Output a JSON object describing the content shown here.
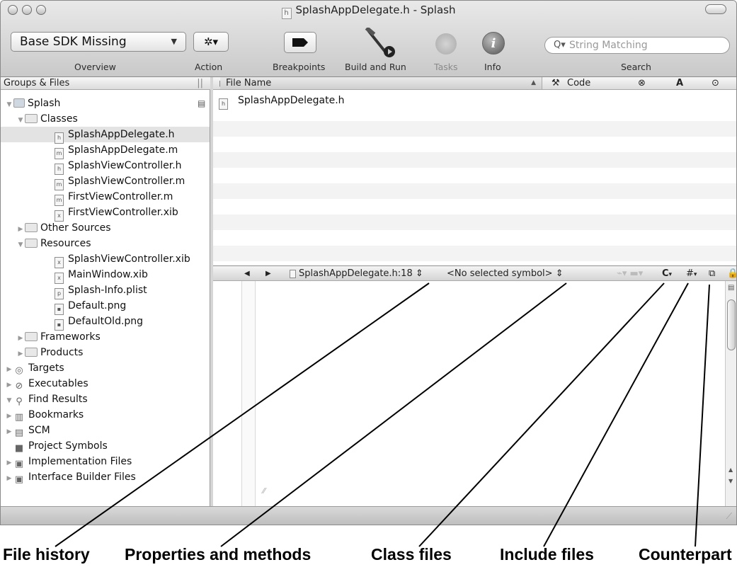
{
  "window": {
    "title": "SplashAppDelegate.h - Splash",
    "title_badge": "h"
  },
  "toolbar": {
    "overview_popup": "Base SDK Missing",
    "overview_label": "Overview",
    "action_label": "Action",
    "breakpoints_label": "Breakpoints",
    "build_run_label": "Build and Run",
    "tasks_label": "Tasks",
    "info_label": "Info",
    "search_placeholder": "String Matching",
    "search_label": "Search"
  },
  "groups": {
    "header": "Groups & Files",
    "items": [
      {
        "label": "Splash"
      },
      {
        "label": "Classes"
      },
      {
        "label": "SplashAppDelegate.h"
      },
      {
        "label": "SplashAppDelegate.m"
      },
      {
        "label": "SplashViewController.h"
      },
      {
        "label": "SplashViewController.m"
      },
      {
        "label": "FirstViewController.m"
      },
      {
        "label": "FirstViewController.xib"
      },
      {
        "label": "Other Sources"
      },
      {
        "label": "Resources"
      },
      {
        "label": "SplashViewController.xib"
      },
      {
        "label": "MainWindow.xib"
      },
      {
        "label": "Splash-Info.plist"
      },
      {
        "label": "Default.png"
      },
      {
        "label": "DefaultOld.png"
      },
      {
        "label": "Frameworks"
      },
      {
        "label": "Products"
      },
      {
        "label": "Targets"
      },
      {
        "label": "Executables"
      },
      {
        "label": "Find Results"
      },
      {
        "label": "Bookmarks"
      },
      {
        "label": "SCM"
      },
      {
        "label": "Project Symbols"
      },
      {
        "label": "Implementation Files"
      },
      {
        "label": "Interface Builder Files"
      }
    ]
  },
  "file_list": {
    "columns": {
      "file_name": "File Name",
      "code": "Code",
      "errors": "⊗",
      "warnings": "A",
      "target": "⊙"
    },
    "rows": [
      "SplashAppDelegate.h"
    ]
  },
  "editor": {
    "file_popup": "SplashAppDelegate.h:18",
    "symbol_popup": "<No selected symbol>",
    "class_menu": "C",
    "include_menu": "#"
  },
  "callouts": {
    "file_history": "File history",
    "properties_methods": "Properties and methods",
    "class_files": "Class files",
    "include_files": "Include files",
    "counterpart": "Counterpart"
  }
}
